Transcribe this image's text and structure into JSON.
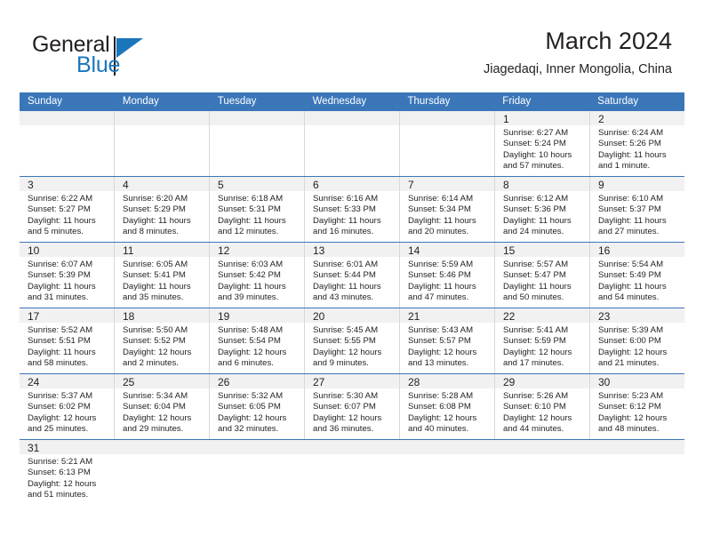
{
  "brand": {
    "name_part1": "General",
    "name_part2": "Blue",
    "accent_color": "#1b75bb"
  },
  "header": {
    "title": "March 2024",
    "subtitle": "Jiagedaqi, Inner Mongolia, China"
  },
  "theme": {
    "header_row_color": "#3a76b8",
    "date_band_color": "#f1f1f1",
    "grid_line_color": "#d8d8d8"
  },
  "weekdays": [
    "Sunday",
    "Monday",
    "Tuesday",
    "Wednesday",
    "Thursday",
    "Friday",
    "Saturday"
  ],
  "weeks": [
    [
      {
        "date": "",
        "empty": true
      },
      {
        "date": "",
        "empty": true
      },
      {
        "date": "",
        "empty": true
      },
      {
        "date": "",
        "empty": true
      },
      {
        "date": "",
        "empty": true
      },
      {
        "date": "1",
        "sunrise": "Sunrise: 6:27 AM",
        "sunset": "Sunset: 5:24 PM",
        "daylight1": "Daylight: 10 hours",
        "daylight2": "and 57 minutes."
      },
      {
        "date": "2",
        "sunrise": "Sunrise: 6:24 AM",
        "sunset": "Sunset: 5:26 PM",
        "daylight1": "Daylight: 11 hours",
        "daylight2": "and 1 minute."
      }
    ],
    [
      {
        "date": "3",
        "sunrise": "Sunrise: 6:22 AM",
        "sunset": "Sunset: 5:27 PM",
        "daylight1": "Daylight: 11 hours",
        "daylight2": "and 5 minutes."
      },
      {
        "date": "4",
        "sunrise": "Sunrise: 6:20 AM",
        "sunset": "Sunset: 5:29 PM",
        "daylight1": "Daylight: 11 hours",
        "daylight2": "and 8 minutes."
      },
      {
        "date": "5",
        "sunrise": "Sunrise: 6:18 AM",
        "sunset": "Sunset: 5:31 PM",
        "daylight1": "Daylight: 11 hours",
        "daylight2": "and 12 minutes."
      },
      {
        "date": "6",
        "sunrise": "Sunrise: 6:16 AM",
        "sunset": "Sunset: 5:33 PM",
        "daylight1": "Daylight: 11 hours",
        "daylight2": "and 16 minutes."
      },
      {
        "date": "7",
        "sunrise": "Sunrise: 6:14 AM",
        "sunset": "Sunset: 5:34 PM",
        "daylight1": "Daylight: 11 hours",
        "daylight2": "and 20 minutes."
      },
      {
        "date": "8",
        "sunrise": "Sunrise: 6:12 AM",
        "sunset": "Sunset: 5:36 PM",
        "daylight1": "Daylight: 11 hours",
        "daylight2": "and 24 minutes."
      },
      {
        "date": "9",
        "sunrise": "Sunrise: 6:10 AM",
        "sunset": "Sunset: 5:37 PM",
        "daylight1": "Daylight: 11 hours",
        "daylight2": "and 27 minutes."
      }
    ],
    [
      {
        "date": "10",
        "sunrise": "Sunrise: 6:07 AM",
        "sunset": "Sunset: 5:39 PM",
        "daylight1": "Daylight: 11 hours",
        "daylight2": "and 31 minutes."
      },
      {
        "date": "11",
        "sunrise": "Sunrise: 6:05 AM",
        "sunset": "Sunset: 5:41 PM",
        "daylight1": "Daylight: 11 hours",
        "daylight2": "and 35 minutes."
      },
      {
        "date": "12",
        "sunrise": "Sunrise: 6:03 AM",
        "sunset": "Sunset: 5:42 PM",
        "daylight1": "Daylight: 11 hours",
        "daylight2": "and 39 minutes."
      },
      {
        "date": "13",
        "sunrise": "Sunrise: 6:01 AM",
        "sunset": "Sunset: 5:44 PM",
        "daylight1": "Daylight: 11 hours",
        "daylight2": "and 43 minutes."
      },
      {
        "date": "14",
        "sunrise": "Sunrise: 5:59 AM",
        "sunset": "Sunset: 5:46 PM",
        "daylight1": "Daylight: 11 hours",
        "daylight2": "and 47 minutes."
      },
      {
        "date": "15",
        "sunrise": "Sunrise: 5:57 AM",
        "sunset": "Sunset: 5:47 PM",
        "daylight1": "Daylight: 11 hours",
        "daylight2": "and 50 minutes."
      },
      {
        "date": "16",
        "sunrise": "Sunrise: 5:54 AM",
        "sunset": "Sunset: 5:49 PM",
        "daylight1": "Daylight: 11 hours",
        "daylight2": "and 54 minutes."
      }
    ],
    [
      {
        "date": "17",
        "sunrise": "Sunrise: 5:52 AM",
        "sunset": "Sunset: 5:51 PM",
        "daylight1": "Daylight: 11 hours",
        "daylight2": "and 58 minutes."
      },
      {
        "date": "18",
        "sunrise": "Sunrise: 5:50 AM",
        "sunset": "Sunset: 5:52 PM",
        "daylight1": "Daylight: 12 hours",
        "daylight2": "and 2 minutes."
      },
      {
        "date": "19",
        "sunrise": "Sunrise: 5:48 AM",
        "sunset": "Sunset: 5:54 PM",
        "daylight1": "Daylight: 12 hours",
        "daylight2": "and 6 minutes."
      },
      {
        "date": "20",
        "sunrise": "Sunrise: 5:45 AM",
        "sunset": "Sunset: 5:55 PM",
        "daylight1": "Daylight: 12 hours",
        "daylight2": "and 9 minutes."
      },
      {
        "date": "21",
        "sunrise": "Sunrise: 5:43 AM",
        "sunset": "Sunset: 5:57 PM",
        "daylight1": "Daylight: 12 hours",
        "daylight2": "and 13 minutes."
      },
      {
        "date": "22",
        "sunrise": "Sunrise: 5:41 AM",
        "sunset": "Sunset: 5:59 PM",
        "daylight1": "Daylight: 12 hours",
        "daylight2": "and 17 minutes."
      },
      {
        "date": "23",
        "sunrise": "Sunrise: 5:39 AM",
        "sunset": "Sunset: 6:00 PM",
        "daylight1": "Daylight: 12 hours",
        "daylight2": "and 21 minutes."
      }
    ],
    [
      {
        "date": "24",
        "sunrise": "Sunrise: 5:37 AM",
        "sunset": "Sunset: 6:02 PM",
        "daylight1": "Daylight: 12 hours",
        "daylight2": "and 25 minutes."
      },
      {
        "date": "25",
        "sunrise": "Sunrise: 5:34 AM",
        "sunset": "Sunset: 6:04 PM",
        "daylight1": "Daylight: 12 hours",
        "daylight2": "and 29 minutes."
      },
      {
        "date": "26",
        "sunrise": "Sunrise: 5:32 AM",
        "sunset": "Sunset: 6:05 PM",
        "daylight1": "Daylight: 12 hours",
        "daylight2": "and 32 minutes."
      },
      {
        "date": "27",
        "sunrise": "Sunrise: 5:30 AM",
        "sunset": "Sunset: 6:07 PM",
        "daylight1": "Daylight: 12 hours",
        "daylight2": "and 36 minutes."
      },
      {
        "date": "28",
        "sunrise": "Sunrise: 5:28 AM",
        "sunset": "Sunset: 6:08 PM",
        "daylight1": "Daylight: 12 hours",
        "daylight2": "and 40 minutes."
      },
      {
        "date": "29",
        "sunrise": "Sunrise: 5:26 AM",
        "sunset": "Sunset: 6:10 PM",
        "daylight1": "Daylight: 12 hours",
        "daylight2": "and 44 minutes."
      },
      {
        "date": "30",
        "sunrise": "Sunrise: 5:23 AM",
        "sunset": "Sunset: 6:12 PM",
        "daylight1": "Daylight: 12 hours",
        "daylight2": "and 48 minutes."
      }
    ],
    [
      {
        "date": "31",
        "sunrise": "Sunrise: 5:21 AM",
        "sunset": "Sunset: 6:13 PM",
        "daylight1": "Daylight: 12 hours",
        "daylight2": "and 51 minutes."
      },
      {
        "date": "",
        "empty": true
      },
      {
        "date": "",
        "empty": true
      },
      {
        "date": "",
        "empty": true
      },
      {
        "date": "",
        "empty": true
      },
      {
        "date": "",
        "empty": true
      },
      {
        "date": "",
        "empty": true
      }
    ]
  ]
}
